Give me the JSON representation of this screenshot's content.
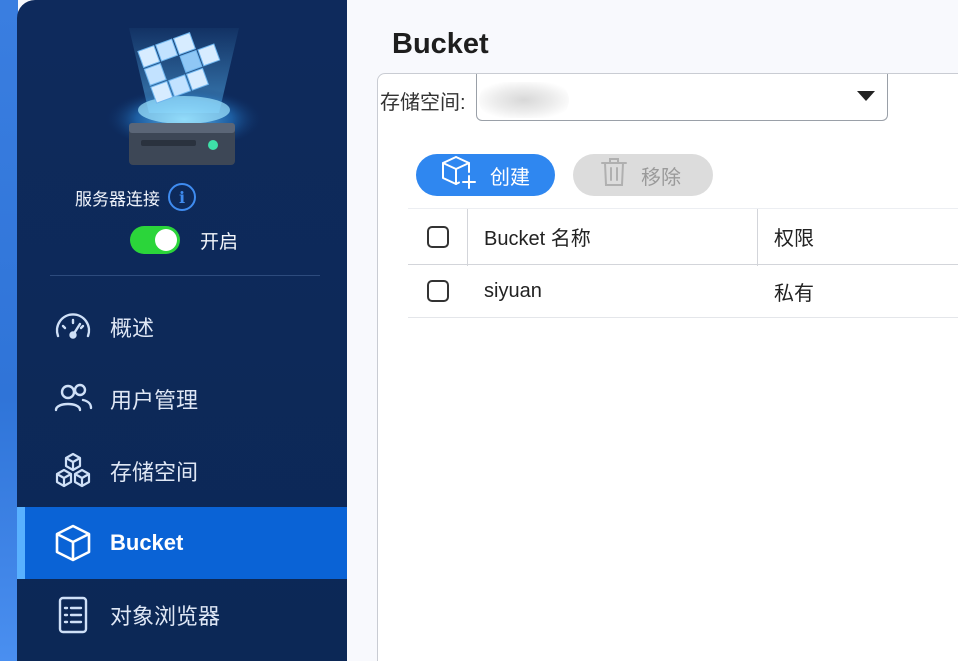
{
  "sidebar": {
    "server_connection_label": "服务器连接",
    "toggle_label": "开启",
    "toggle_on": true,
    "items": [
      {
        "label": "概述",
        "icon": "speedometer-icon"
      },
      {
        "label": "用户管理",
        "icon": "users-icon"
      },
      {
        "label": "存储空间",
        "icon": "cubes-icon"
      },
      {
        "label": "Bucket",
        "icon": "cube-icon",
        "active": true
      },
      {
        "label": "对象浏览器",
        "icon": "document-list-icon"
      }
    ]
  },
  "main": {
    "title": "Bucket",
    "storage_label": "存储空间:",
    "storage_value": "",
    "create_label": "创建",
    "remove_label": "移除",
    "table": {
      "headers": [
        "Bucket 名称",
        "权限"
      ],
      "rows": [
        {
          "name": "siyuan",
          "permission": "私有"
        }
      ]
    }
  },
  "colors": {
    "sidebar_bg": "#0e2a5c",
    "active_item": "#0a63d6",
    "accent": "#2f87f0",
    "toggle_on": "#2bd53a"
  }
}
